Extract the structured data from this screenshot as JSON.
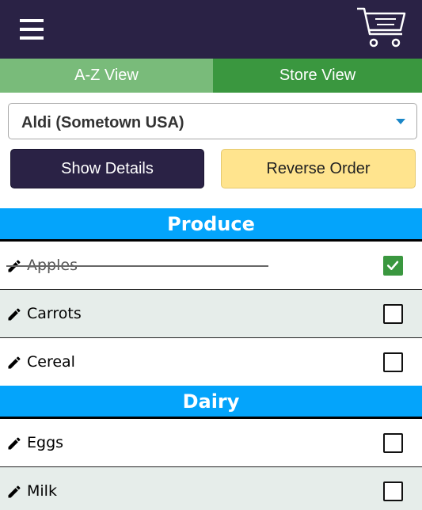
{
  "header": {
    "menu_icon": "hamburger-menu-icon",
    "cart_icon": "shopping-cart-icon"
  },
  "tabs": [
    {
      "label": "A-Z View",
      "active": false
    },
    {
      "label": "Store View",
      "active": true
    }
  ],
  "store_select": {
    "value": "Aldi (Sometown USA)"
  },
  "buttons": {
    "show_details": "Show Details",
    "reverse_order": "Reverse Order"
  },
  "sections": [
    {
      "title": "Produce",
      "items": [
        {
          "name": "Apples",
          "checked": true
        },
        {
          "name": "Carrots",
          "checked": false
        },
        {
          "name": "Cereal",
          "checked": false
        }
      ]
    },
    {
      "title": "Dairy",
      "items": [
        {
          "name": "Eggs",
          "checked": false
        },
        {
          "name": "Milk",
          "checked": false
        }
      ]
    }
  ],
  "colors": {
    "header_bg": "#2a2245",
    "tab_inactive": "#79bb7a",
    "tab_active": "#3a973f",
    "section_bg": "#04a4fb",
    "reverse_button": "#ffe48e",
    "row_alt": "#e6edea"
  }
}
